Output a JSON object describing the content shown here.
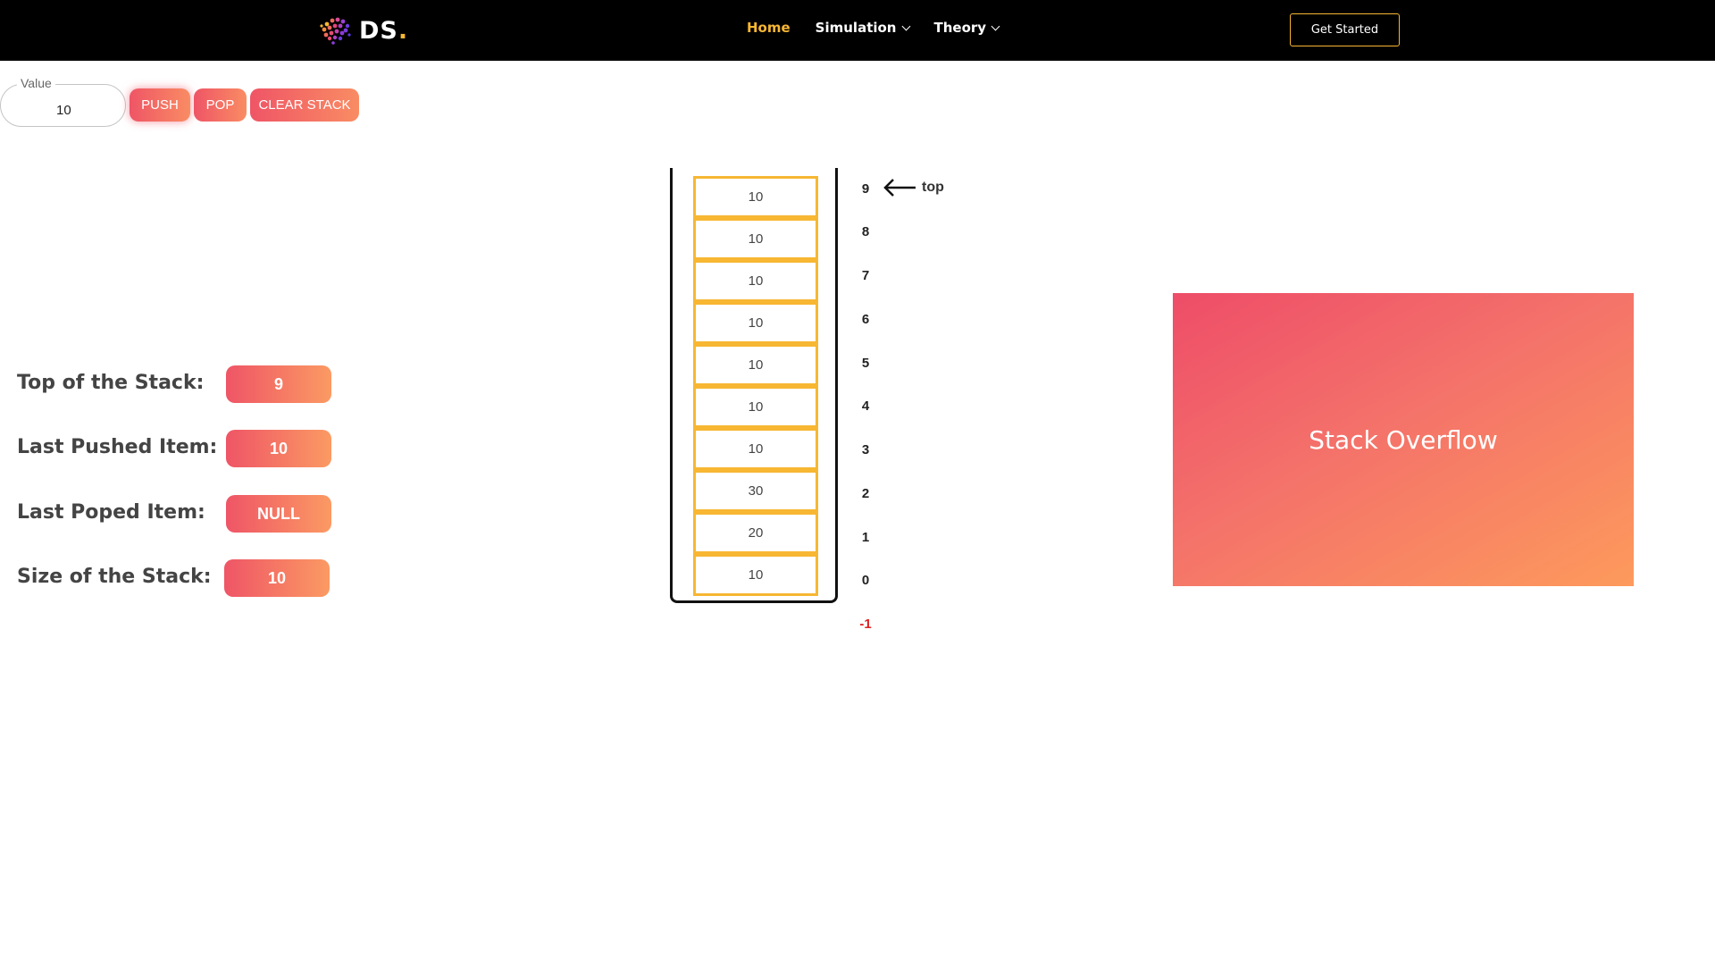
{
  "nav": {
    "logo_text": "DS",
    "logo_dot": ".",
    "links": [
      {
        "label": "Home",
        "active": true
      },
      {
        "label": "Simulation",
        "dropdown": true
      },
      {
        "label": "Theory",
        "dropdown": true
      }
    ],
    "cta_label": "Get Started"
  },
  "controls": {
    "value_label": "Value",
    "value": "10",
    "push_label": "PUSH",
    "pop_label": "POP",
    "clear_label": "CLEAR STACK"
  },
  "info": {
    "top_label": "Top of the Stack:",
    "top_value": "9",
    "last_pushed_label": "Last Pushed Item:",
    "last_pushed_value": "10",
    "last_popped_label": "Last Poped Item:",
    "last_popped_value": "NULL",
    "size_label": "Size of the Stack:",
    "size_value": "10"
  },
  "stack": {
    "items_top_to_bottom": [
      "10",
      "10",
      "10",
      "10",
      "10",
      "10",
      "10",
      "30",
      "20",
      "10"
    ],
    "indices": [
      "9",
      "8",
      "7",
      "6",
      "5",
      "4",
      "3",
      "2",
      "1",
      "0",
      "-1"
    ],
    "top_pointer_label": "top"
  },
  "overflow": {
    "message": "Stack Overflow"
  },
  "colors": {
    "accent": "#f7b733",
    "gradient_start": "#ef5566",
    "gradient_end": "#fb9a63",
    "negative_index": "#e02020"
  }
}
